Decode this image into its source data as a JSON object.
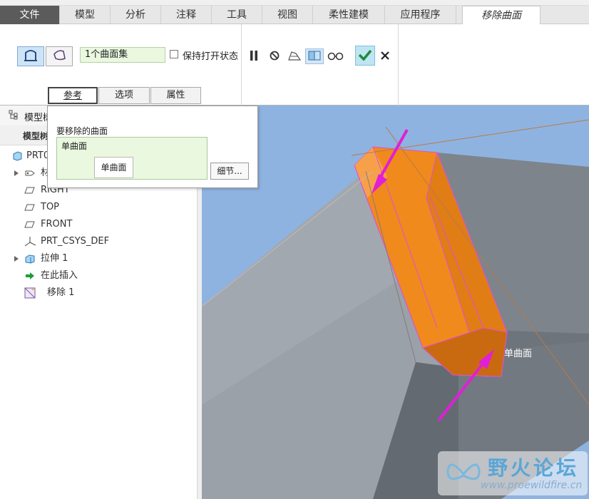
{
  "tabs": [
    "文件",
    "模型",
    "分析",
    "注释",
    "工具",
    "视图",
    "柔性建模",
    "应用程序",
    "移除曲面"
  ],
  "active_tab": "移除曲面",
  "ribbon": {
    "surface_set_value": "1个曲面集",
    "keep_open_label": "保持打开状态",
    "keep_open_checked": false,
    "subtabs": [
      "参考",
      "选项",
      "属性"
    ],
    "active_subtab": "参考",
    "icons": {
      "surface_mode": "surface-select-icon",
      "chain_mode": "chain-select-icon",
      "pause": "pause-icon",
      "stop": "no-preview-icon",
      "preview1": "preview-icon",
      "preview2": "verify-preview-icon",
      "glasses": "glasses-preview-icon",
      "confirm": "checkmark-icon",
      "cancel": "close-icon"
    }
  },
  "tree": {
    "header_label": "模型树",
    "sub_label": "模型树",
    "items": [
      {
        "label": "PRT0",
        "icon": "part-icon"
      },
      {
        "label": "材",
        "icon": "material-icon",
        "expandable": true
      },
      {
        "label": "RIGHT",
        "icon": "datum-plane-icon"
      },
      {
        "label": "TOP",
        "icon": "datum-plane-icon"
      },
      {
        "label": "FRONT",
        "icon": "datum-plane-icon"
      },
      {
        "label": "PRT_CSYS_DEF",
        "icon": "csys-icon"
      },
      {
        "label": "拉伸 1",
        "icon": "extrude-icon",
        "expandable": true
      },
      {
        "label": "在此插入",
        "icon": "insert-here-arrow-icon"
      },
      {
        "label": "移除 1",
        "icon": "remove-feature-icon"
      }
    ]
  },
  "panel": {
    "title": "要移除的曲面",
    "list_items": [
      "单曲面"
    ],
    "tooltip": "单曲面",
    "details_button": "细节..."
  },
  "viewport": {
    "label": "单曲面",
    "colors": {
      "background": "#8fb3e0",
      "selected_surface": "#f08a1c",
      "arrow": "#e11fd6"
    }
  },
  "watermark": {
    "title": "野火论坛",
    "url": "www.proewildfire.cn"
  }
}
